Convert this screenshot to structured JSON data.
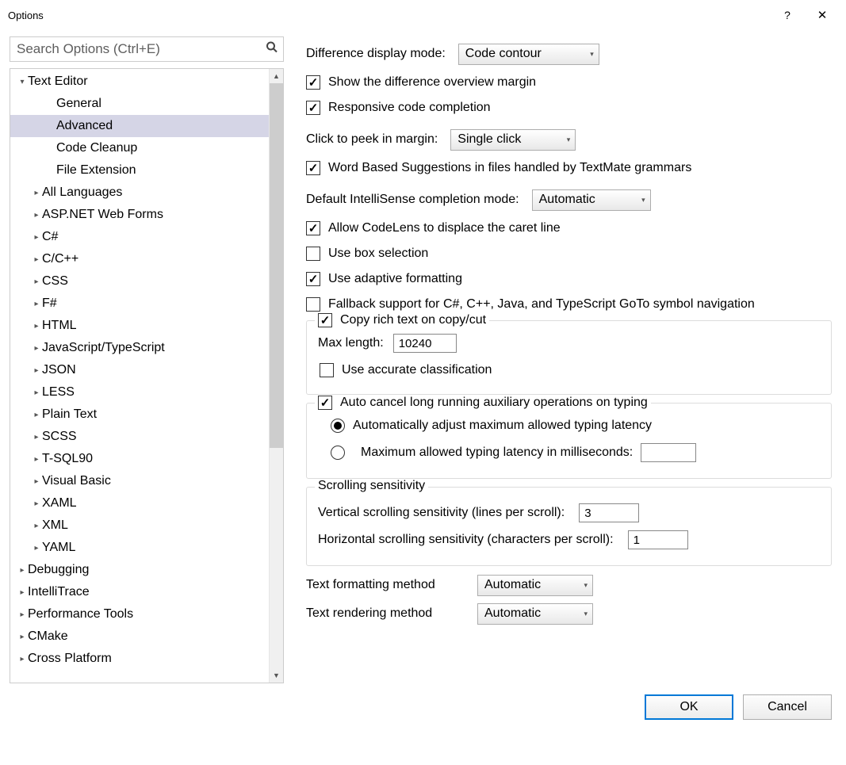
{
  "window": {
    "title": "Options",
    "help": "?",
    "close": "✕"
  },
  "search": {
    "placeholder": "Search Options (Ctrl+E)"
  },
  "tree": {
    "root": "Text Editor",
    "subs": [
      "General",
      "Advanced",
      "Code Cleanup",
      "File Extension"
    ],
    "langs": [
      "All Languages",
      "ASP.NET Web Forms",
      "C#",
      "C/C++",
      "CSS",
      "F#",
      "HTML",
      "JavaScript/TypeScript",
      "JSON",
      "LESS",
      "Plain Text",
      "SCSS",
      "T-SQL90",
      "Visual Basic",
      "XAML",
      "XML",
      "YAML"
    ],
    "others": [
      "Debugging",
      "IntelliTrace",
      "Performance Tools",
      "CMake",
      "Cross Platform"
    ]
  },
  "opt": {
    "diff_label": "Difference display mode:",
    "diff_value": "Code contour",
    "show_diff_margin": "Show the difference overview margin",
    "responsive_cc": "Responsive code completion",
    "peek_label": "Click to peek in margin:",
    "peek_value": "Single click",
    "word_sugg": "Word Based Suggestions in files handled by TextMate grammars",
    "intelli_label": "Default IntelliSense completion mode:",
    "intelli_value": "Automatic",
    "codelens": "Allow CodeLens to displace the caret line",
    "boxsel": "Use box selection",
    "adaptive": "Use adaptive formatting",
    "fallback": "Fallback support for C#, C++, Java, and TypeScript GoTo symbol navigation",
    "copyrich": "Copy rich text on copy/cut",
    "maxlen_label": "Max length:",
    "maxlen_value": "10240",
    "accurate": "Use accurate classification",
    "autocancel": "Auto cancel long running auxiliary operations on typing",
    "radio_auto": "Automatically adjust maximum allowed typing latency",
    "radio_ms": "Maximum allowed typing latency in milliseconds:",
    "scroll_title": "Scrolling sensitivity",
    "vscroll_label": "Vertical scrolling sensitivity (lines per scroll):",
    "vscroll_value": "3",
    "hscroll_label": "Horizontal scrolling sensitivity (characters per scroll):",
    "hscroll_value": "1",
    "tfmt_label": "Text formatting method",
    "tfmt_value": "Automatic",
    "trender_label": "Text rendering method",
    "trender_value": "Automatic"
  },
  "footer": {
    "ok": "OK",
    "cancel": "Cancel"
  }
}
